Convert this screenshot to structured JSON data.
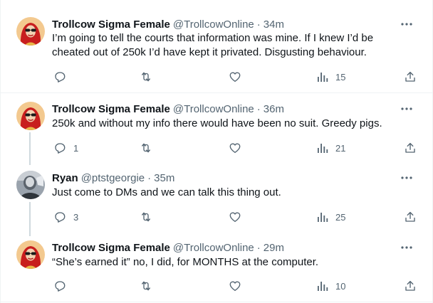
{
  "tweets": [
    {
      "author": {
        "name": "Trollcow Sigma Female",
        "handle": "@TrollcowOnline",
        "avatar": "red-haired-avatar"
      },
      "time": "34m",
      "lines": [
        "I’m going to tell the courts that information was mine. If I knew I’d be",
        "cheated out of 250k I’d have kept it privated. Disgusting behaviour."
      ],
      "stats": {
        "replies": "",
        "retweets": "",
        "likes": "",
        "views": "15"
      }
    },
    {
      "author": {
        "name": "Trollcow Sigma Female",
        "handle": "@TrollcowOnline",
        "avatar": "red-haired-avatar"
      },
      "time": "36m",
      "lines": [
        "250k and without my info there would have been no suit. Greedy pigs."
      ],
      "stats": {
        "replies": "1",
        "retweets": "",
        "likes": "",
        "views": "21"
      }
    },
    {
      "author": {
        "name": "Ryan",
        "handle": "@ptstgeorgie",
        "avatar": "grey-photo-avatar"
      },
      "time": "35m",
      "lines": [
        "Just come to DMs and we can talk this thing out."
      ],
      "stats": {
        "replies": "3",
        "retweets": "",
        "likes": "",
        "views": "25"
      }
    },
    {
      "author": {
        "name": "Trollcow Sigma Female",
        "handle": "@TrollcowOnline",
        "avatar": "red-haired-avatar"
      },
      "time": "29m",
      "lines": [
        "“She’s earned it” no, I did, for MONTHS at the computer."
      ],
      "stats": {
        "replies": "",
        "retweets": "",
        "likes": "",
        "views": "10"
      }
    }
  ],
  "separator": "·",
  "icons": {
    "more": "more-icon",
    "reply": "reply-icon",
    "retweet": "retweet-icon",
    "like": "like-icon",
    "views": "views-icon",
    "share": "share-icon"
  },
  "colors": {
    "text": "#0f1419",
    "secondary": "#536471",
    "divider": "#eff3f4",
    "thread_line": "#cfd9de"
  }
}
